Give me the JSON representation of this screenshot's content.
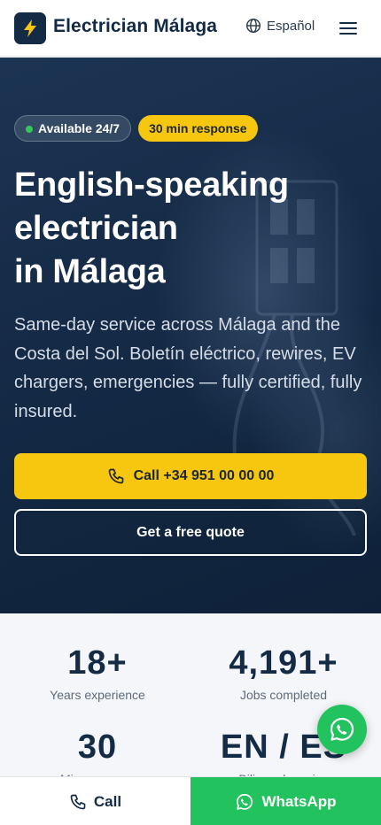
{
  "header": {
    "brand": "Electrician Málaga",
    "language_label": "Español"
  },
  "hero": {
    "badge_available": "Available 24/7",
    "badge_response": "30 min response",
    "title_lines": [
      "English-speaking",
      "electrician",
      "in Málaga"
    ],
    "description": "Same-day service across Málaga and the Costa del Sol. Boletín eléctrico, rewires, EV chargers, emergencies — fully certified, fully insured.",
    "call_button": "Call +34 951 00 00 00",
    "quote_button": "Get a free quote"
  },
  "stats": [
    {
      "value": "18+",
      "label": "Years experience"
    },
    {
      "value": "4,191+",
      "label": "Jobs completed"
    },
    {
      "value": "30",
      "label": "Min response"
    },
    {
      "value": "EN / ES",
      "label": "Bilingual service"
    }
  ],
  "bottom_bar": {
    "call_label": "Call",
    "whatsapp_label": "WhatsApp"
  },
  "colors": {
    "brand_navy": "#142b46",
    "accent_yellow": "#f7c60f",
    "whatsapp_green": "#22c35e",
    "available_dot": "#34c759"
  },
  "icons": [
    "lightning-bolt-icon",
    "globe-icon",
    "hamburger-menu-icon",
    "phone-icon",
    "whatsapp-icon"
  ]
}
